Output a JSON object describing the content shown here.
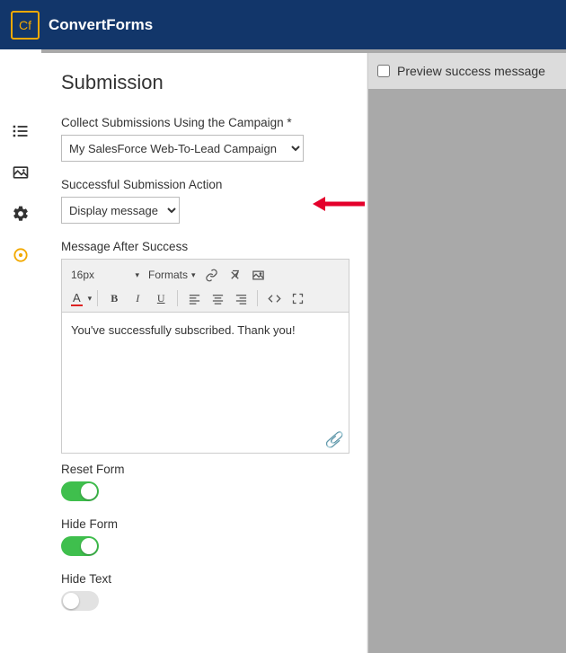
{
  "brand": {
    "logo_text": "Cf",
    "name": "ConvertForms"
  },
  "preview": {
    "label": "Preview success message",
    "checked": false
  },
  "panel": {
    "title": "Submission",
    "campaign_label": "Collect Submissions Using the Campaign *",
    "campaign_value": "My SalesForce Web-To-Lead Campaign",
    "action_label": "Successful Submission Action",
    "action_value": "Display message",
    "message_label": "Message After Success",
    "editor": {
      "fontsize": "16px",
      "formats_label": "Formats",
      "content": "You've successfully subscribed. Thank you!"
    },
    "reset_label": "Reset Form",
    "reset_on": true,
    "hideform_label": "Hide Form",
    "hideform_on": true,
    "hidetext_label": "Hide Text",
    "hidetext_on": false
  }
}
